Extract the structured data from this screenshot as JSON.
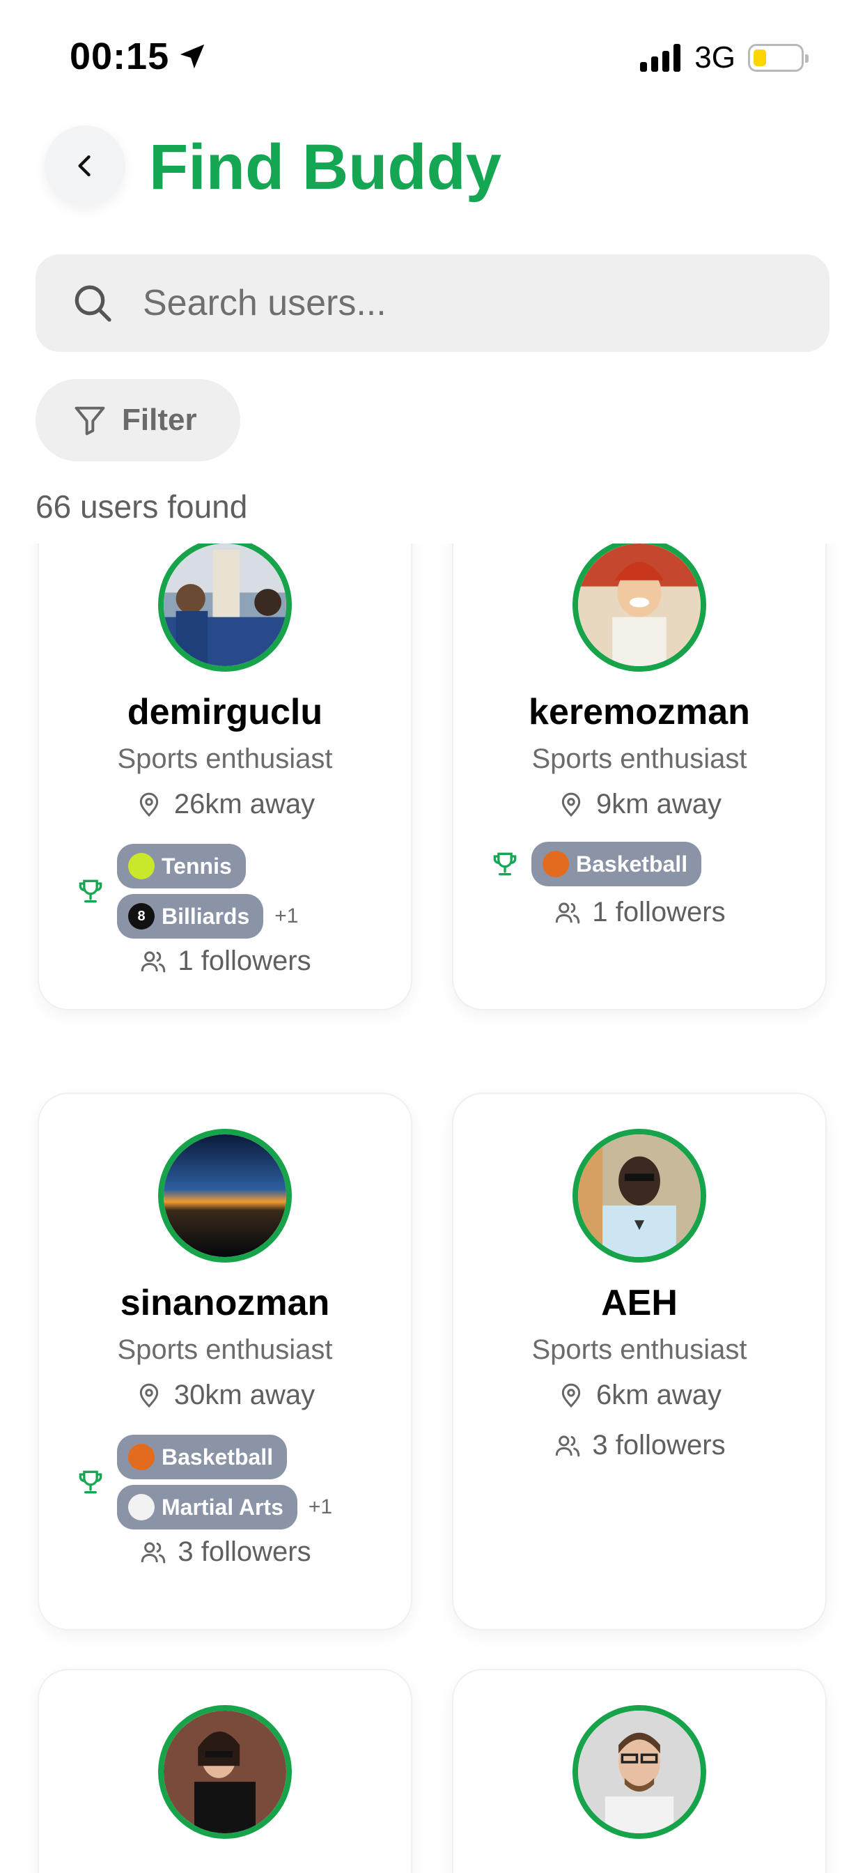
{
  "status_bar": {
    "time": "00:15",
    "network": "3G"
  },
  "header": {
    "title": "Find Buddy"
  },
  "search": {
    "placeholder": "Search users..."
  },
  "filter": {
    "label": "Filter"
  },
  "results": {
    "count_text": "66 users found"
  },
  "users": [
    {
      "username": "demirguclu",
      "bio": "Sports enthusiast",
      "distance": "26km away",
      "sports": [
        {
          "name": "Tennis",
          "icon": "tennis-ball-icon"
        },
        {
          "name": "Billiards",
          "icon": "billiard-ball-icon"
        }
      ],
      "more": "+1",
      "followers": "1 followers"
    },
    {
      "username": "keremozman",
      "bio": "Sports enthusiast",
      "distance": "9km away",
      "sports": [
        {
          "name": "Basketball",
          "icon": "basketball-icon"
        }
      ],
      "followers": "1 followers"
    },
    {
      "username": "sinanozman",
      "bio": "Sports enthusiast",
      "distance": "30km away",
      "sports": [
        {
          "name": "Basketball",
          "icon": "basketball-icon"
        },
        {
          "name": "Martial Arts",
          "icon": "martial-arts-icon"
        }
      ],
      "more": "+1",
      "followers": "3 followers"
    },
    {
      "username": "AEH",
      "bio": "Sports enthusiast",
      "distance": "6km away",
      "followers": "3 followers"
    },
    {
      "username": "",
      "bio": "",
      "distance": "",
      "followers": ""
    },
    {
      "username": "",
      "bio": "",
      "distance": "",
      "followers": ""
    }
  ],
  "colors": {
    "accent": "#14a653",
    "avatar_ring": "#16a34a",
    "chip_bg": "#8a94a6",
    "battery": "#ffd400"
  }
}
